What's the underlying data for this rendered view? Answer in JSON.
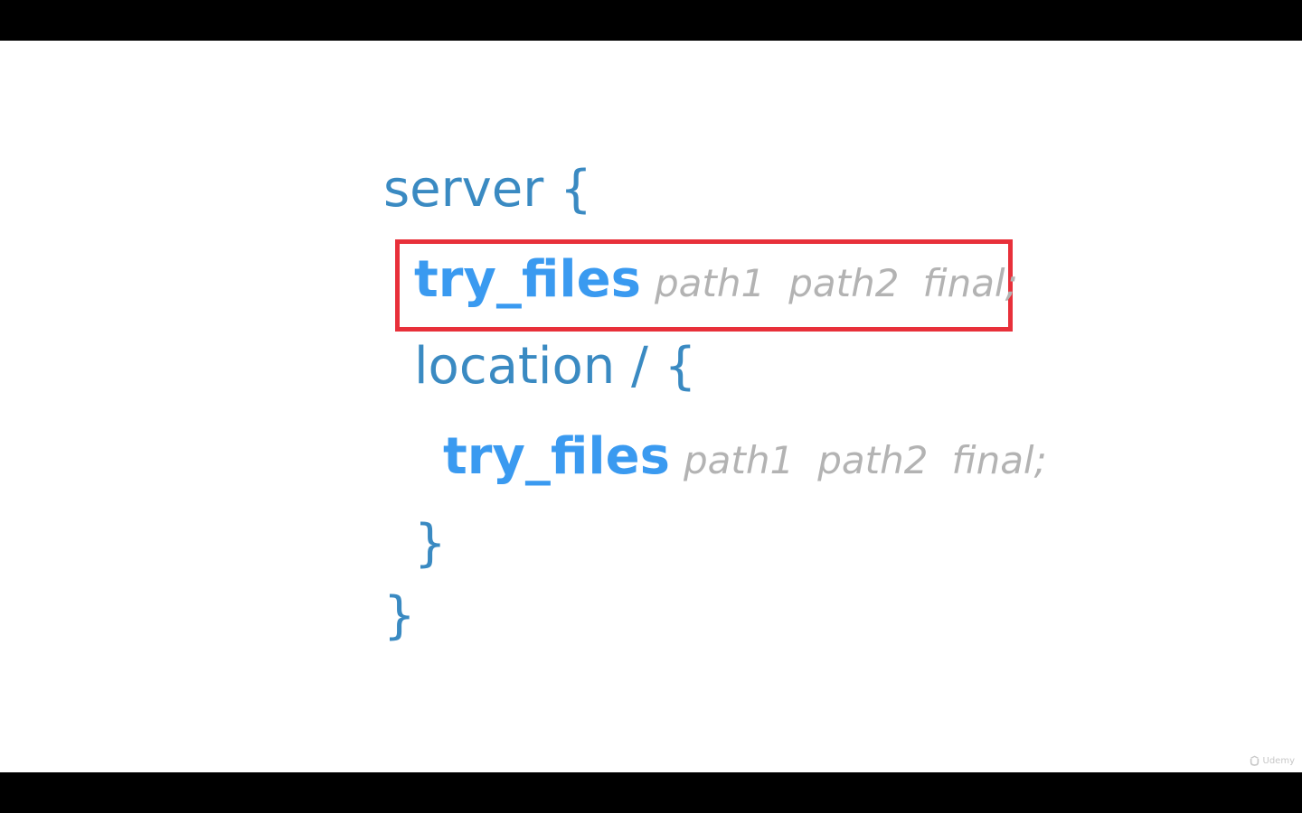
{
  "slide": {
    "lines": [
      {
        "text": "server {"
      },
      {
        "directive": "try_files",
        "args": [
          "path1",
          "path2",
          "final;"
        ]
      },
      {
        "text": "location / {"
      },
      {
        "directive": "try_files",
        "args": [
          "path1",
          "path2",
          "final;"
        ]
      },
      {
        "text": "}"
      },
      {
        "text": "}"
      }
    ]
  },
  "watermark": {
    "text": "Udemy",
    "icon": "udemy-logo-icon"
  },
  "colors": {
    "letterbox": "#000000",
    "background": "#ffffff",
    "code_plain": "#3a8ac2",
    "directive": "#3a9af0",
    "argument": "#b3b3b3",
    "highlight_border": "#e8303a"
  }
}
